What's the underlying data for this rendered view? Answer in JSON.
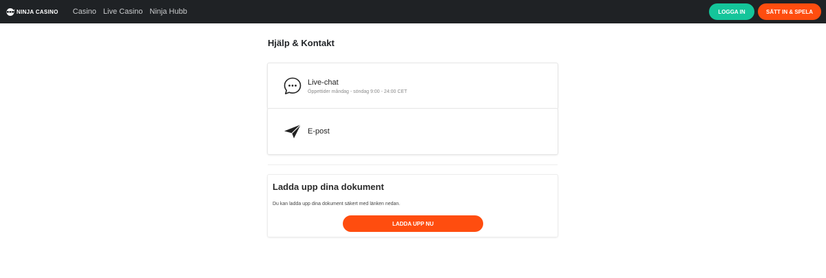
{
  "header": {
    "logo_text": "NINJA CASINO",
    "nav": [
      {
        "label": "Casino"
      },
      {
        "label": "Live Casino"
      },
      {
        "label": "Ninja Hubb"
      }
    ],
    "login_label": "LOGGA IN",
    "deposit_label": "SÄTT IN & SPELA"
  },
  "main": {
    "title": "Hjälp & Kontakt",
    "contacts": [
      {
        "title": "Live-chat",
        "subtitle": "Öppettider måndag - söndag 9:00 - 24:00 CET",
        "icon": "chat-bubble-icon"
      },
      {
        "title": "E-post",
        "icon": "paper-plane-icon"
      }
    ],
    "upload": {
      "title": "Ladda upp dina dokument",
      "description": "Du kan ladda upp dina dokument säkert med länken nedan.",
      "button_label": "LADDA UPP NU"
    }
  },
  "colors": {
    "header_bg": "#1f2225",
    "login_green": "#14c59a",
    "accent_orange": "#ff4d0f"
  }
}
